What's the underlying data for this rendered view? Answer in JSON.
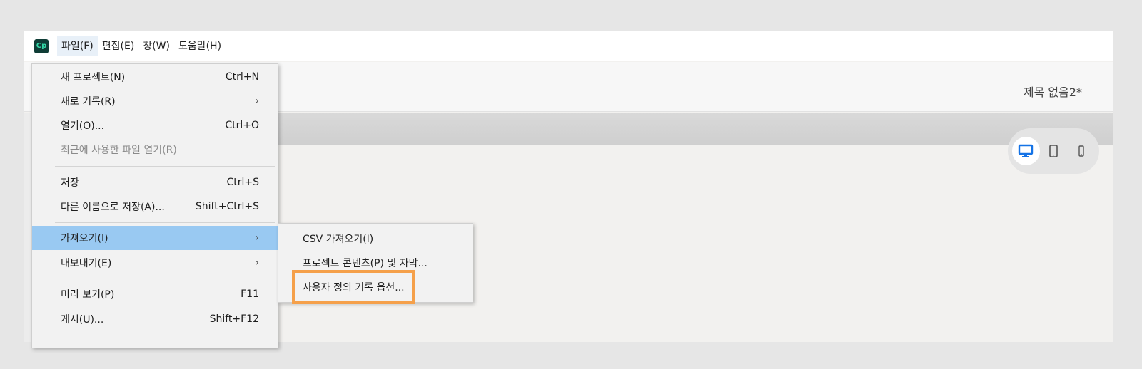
{
  "menubar": {
    "logo_text": "Cp",
    "items": [
      {
        "label": "파일(F)"
      },
      {
        "label": "편집(E)"
      },
      {
        "label": "창(W)"
      },
      {
        "label": "도움말(H)"
      }
    ]
  },
  "document": {
    "title": "제목 없음2*"
  },
  "device_switcher": {
    "items": [
      {
        "icon": "desktop-icon",
        "active": true
      },
      {
        "icon": "tablet-icon",
        "active": false
      },
      {
        "icon": "phone-icon",
        "active": false
      }
    ],
    "accent_color": "#1473e6"
  },
  "file_menu": {
    "items": [
      {
        "label": "새 프로젝트(N)",
        "shortcut": "Ctrl+N"
      },
      {
        "label": "새로 기록(R)",
        "submenu_arrow": "›"
      },
      {
        "label": "열기(O)...",
        "shortcut": "Ctrl+O"
      },
      {
        "label": "최근에 사용한 파일 열기(R)",
        "disabled": true
      },
      {
        "label": "저장",
        "shortcut": "Ctrl+S"
      },
      {
        "label": "다른 이름으로 저장(A)...",
        "shortcut": "Shift+Ctrl+S"
      },
      {
        "label": "가져오기(I)",
        "submenu_arrow": "›",
        "highlighted": true
      },
      {
        "label": "내보내기(E)",
        "submenu_arrow": "›"
      },
      {
        "label": "미리 보기(P)",
        "shortcut": "F11"
      },
      {
        "label": "게시(U)...",
        "shortcut": "Shift+F12"
      }
    ]
  },
  "import_submenu": {
    "items": [
      {
        "label": "CSV 가져오기(I)"
      },
      {
        "label": "프로젝트 콘텐츠(P) 및 자막..."
      },
      {
        "label": "사용자 정의 기록 옵션..."
      }
    ],
    "callout_color": "#f5a04a"
  }
}
